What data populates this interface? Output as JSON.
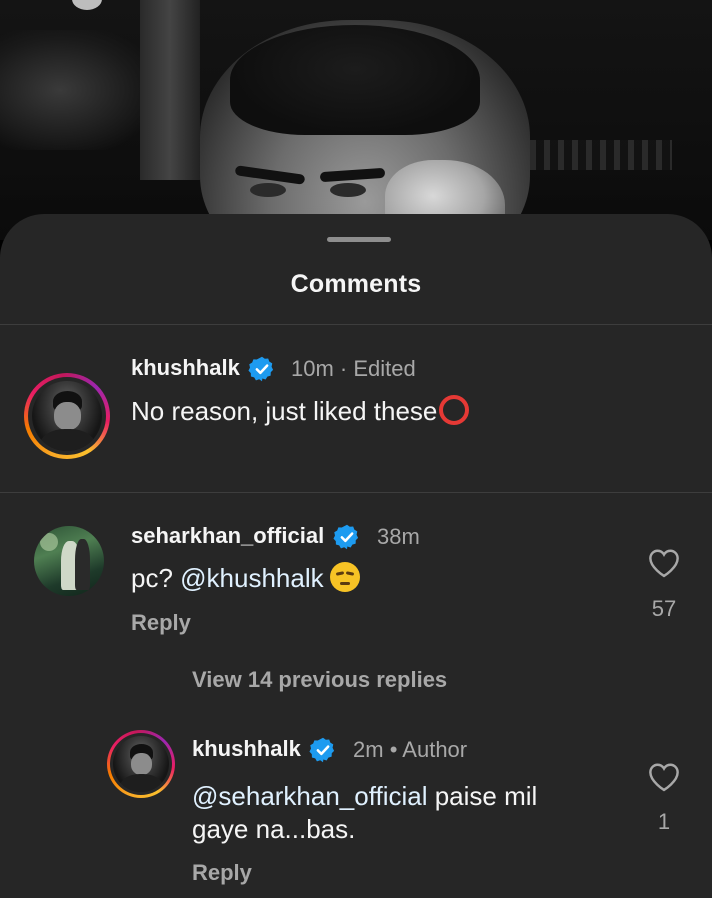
{
  "sheet": {
    "title": "Comments"
  },
  "comments": [
    {
      "username": "khushhalk",
      "time": "10m",
      "edited": "· Edited",
      "text": "No reason, just liked these"
    },
    {
      "username": "seharkhan_official",
      "time": "38m",
      "text_prefix": "pc? ",
      "mention": "@khushhalk",
      "reply_label": "Reply",
      "like_count": "57",
      "view_replies": "View 14 previous replies"
    },
    {
      "username": "khushhalk",
      "time": "2m",
      "dot": "•",
      "author_badge": "Author",
      "mention": "@seharkhan_official",
      "text_line1_rest": " paise mil",
      "text_line2": "gaye na...bas.",
      "reply_label": "Reply",
      "like_count": "1"
    }
  ],
  "icons": {
    "verified": "verified-badge-icon",
    "heart": "heart-outline-icon",
    "ring_emoji": "red-circle-emoji",
    "face_emoji": "unamused-face-emoji"
  },
  "colors": {
    "sheet_bg": "#262626",
    "verified": "#1d9bf0",
    "secondary_text": "#a8a8a8"
  }
}
